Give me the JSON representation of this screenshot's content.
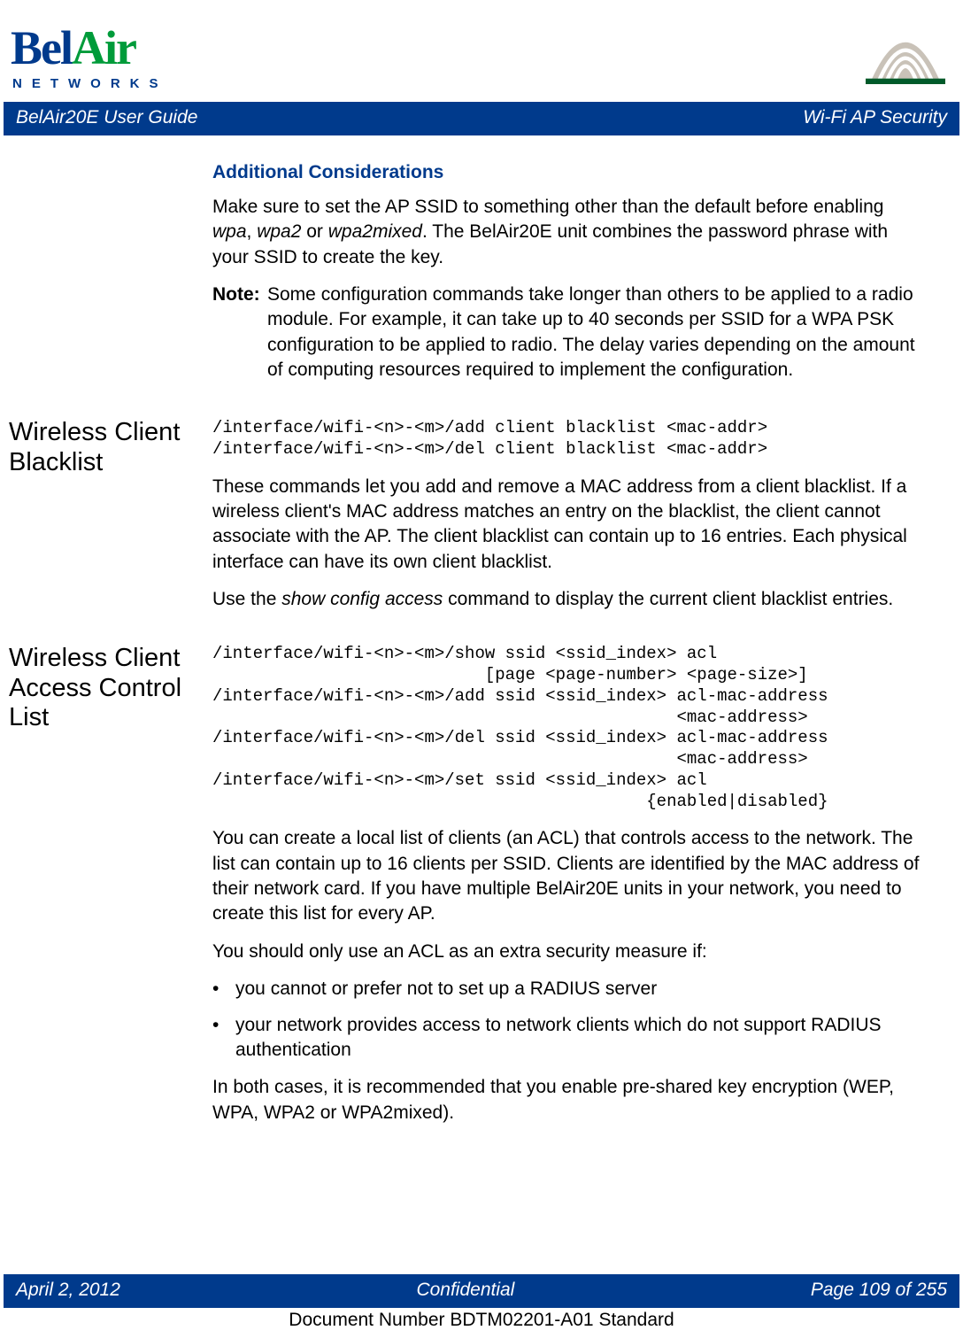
{
  "logo": {
    "brand_a": "Bel",
    "brand_b": "Air",
    "sub": "NETWORKS"
  },
  "docbar": {
    "left": "BelAir20E User Guide",
    "right": "Wi-Fi AP Security"
  },
  "s1": {
    "heading": "Additional Considerations",
    "p1a": "Make sure to set the AP SSID to something other than the default before enabling ",
    "p1_wpa": "wpa",
    "p1_c1": ", ",
    "p1_wpa2": "wpa2",
    "p1_c2": " or ",
    "p1_wpa2m": "wpa2mixed",
    "p1b": ". The BelAir20E unit combines the password phrase with your SSID to create the key.",
    "note_label": "Note:",
    "note_text": "Some configuration commands take longer than others to be applied to a radio module. For example, it can take up to 40 seconds per SSID for a WPA PSK configuration to be applied to radio. The delay varies depending on the amount of computing resources required to implement the configuration."
  },
  "s2": {
    "side": "Wireless Client Blacklist",
    "code": "/interface/wifi-<n>-<m>/add client blacklist <mac-addr>\n/interface/wifi-<n>-<m>/del client blacklist <mac-addr>",
    "p1": "These commands let you add and remove a MAC address from a client blacklist. If a wireless client's MAC address matches an entry on the blacklist, the client cannot associate with the AP. The client blacklist can contain up to 16 entries. Each physical interface can have its own client blacklist.",
    "p2a": "Use the ",
    "p2_cmd": "show config access",
    "p2b": " command to display the current client blacklist entries."
  },
  "s3": {
    "side": "Wireless Client Access Control List",
    "code": "/interface/wifi-<n>-<m>/show ssid <ssid_index> acl\n                           [page <page-number> <page-size>]\n/interface/wifi-<n>-<m>/add ssid <ssid_index> acl-mac-address\n                                              <mac-address>\n/interface/wifi-<n>-<m>/del ssid <ssid_index> acl-mac-address\n                                              <mac-address>\n/interface/wifi-<n>-<m>/set ssid <ssid_index> acl\n                                           {enabled|disabled}",
    "p1": "You can create a local list of clients (an ACL) that controls access to the network. The list can contain up to 16 clients per SSID. Clients are identified by the MAC address of their network card. If you have multiple BelAir20E units in your network, you need to create this list for every AP.",
    "p2": "You should only use an ACL as an extra security measure if:",
    "b1": "you cannot or prefer not to set up a RADIUS server",
    "b2": "your network provides access to network clients which do not support RADIUS authentication",
    "p3": "In both cases, it is recommended that you enable pre-shared key encryption (WEP, WPA, WPA2 or WPA2mixed)."
  },
  "footer": {
    "date": "April 2, 2012",
    "center": "Confidential",
    "page": "Page 109 of 255",
    "docnum": "Document Number BDTM02201-A01 Standard"
  }
}
